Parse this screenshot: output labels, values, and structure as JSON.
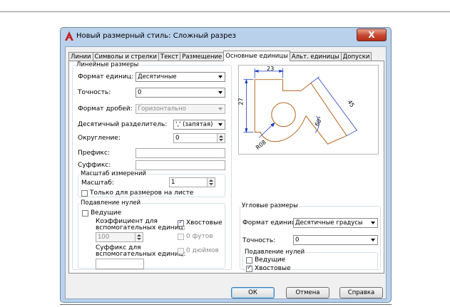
{
  "window": {
    "title": "Новый размерный стиль: Сложный разрез",
    "close_label": "X"
  },
  "tabs": [
    "Линии",
    "Символы и стрелки",
    "Текст",
    "Размещение",
    "Основные единицы",
    "Альт. единицы",
    "Допуски"
  ],
  "active_tab": "Основные единицы",
  "linear": {
    "legend": "Линейные размеры",
    "unit_format_label": "Формат единиц:",
    "unit_format_value": "Десятичные",
    "precision_label": "Точность:",
    "precision_value": "0",
    "fraction_format_label": "Формат дробей:",
    "fraction_format_value": "Горизонтально",
    "decimal_sep_label": "Десятичный разделитель:",
    "decimal_sep_value": "',' (запятая)",
    "roundoff_label": "Округление:",
    "roundoff_value": "0",
    "prefix_label": "Префикс:",
    "prefix_value": "",
    "suffix_label": "Суффикс:",
    "suffix_value": ""
  },
  "scale": {
    "legend": "Масштаб измерений",
    "scale_label": "Масштаб:",
    "scale_value": "1",
    "layout_only_label": "Только для размеров на листе",
    "layout_only_checked": false
  },
  "zero_suppression": {
    "legend": "Подавление нулей",
    "leading_label": "Ведущие",
    "leading_checked": false,
    "sub_factor_label_1": "Коэффициент для",
    "sub_factor_label_2": "вспомогательных единиц:",
    "sub_factor_value": "100",
    "trailing_label": "Хвостовые",
    "trailing_checked": true,
    "feet_label": "0 футов",
    "sub_suffix_label_1": "Суффикс для",
    "sub_suffix_label_2": "вспомогательных единиц:",
    "sub_suffix_value": "",
    "inches_label": "0 дюймов"
  },
  "angular": {
    "legend": "Угловые размеры",
    "unit_format_label": "Формат единиц:",
    "unit_format_value": "Десятичные градусы",
    "precision_label": "Точность:",
    "precision_value": "0",
    "zero_legend": "Подавление нулей",
    "leading_label": "Ведущие",
    "leading_checked": false,
    "trailing_label": "Хвостовые",
    "trailing_checked": true
  },
  "preview": {
    "dim_top": "23",
    "dim_left": "27",
    "dim_right": "45",
    "dim_angle": "60°",
    "dim_radius": "R08"
  },
  "buttons": {
    "ok": "ОК",
    "cancel": "Отмена",
    "help": "Справка"
  },
  "colors": {
    "accent": "#1a3f8f",
    "preview_geometry": "#b5651d",
    "preview_dims": "#1f3fbf"
  }
}
